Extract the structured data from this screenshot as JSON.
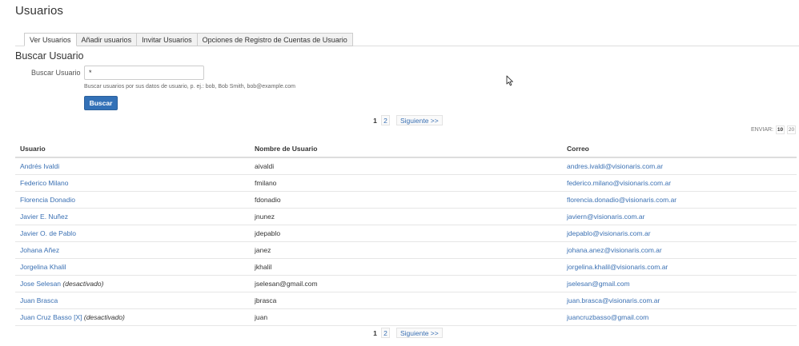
{
  "page": {
    "title": "Usuarios"
  },
  "tabs": [
    {
      "label": "Ver Usuarios",
      "active": true
    },
    {
      "label": "Añadir usuarios",
      "active": false
    },
    {
      "label": "Invitar Usuarios",
      "active": false
    },
    {
      "label": "Opciones de Registro de Cuentas de Usuario",
      "active": false
    }
  ],
  "search": {
    "section_title": "Buscar Usuario",
    "label": "Buscar Usuario",
    "value": "*",
    "help": "Buscar usuarios por sus datos de usuario, p. ej.: bob, Bob Smith, bob@example.com",
    "button_label": "Buscar"
  },
  "pagination": {
    "current": "1",
    "pages": [
      "2"
    ],
    "next_label": "Siguiente >>"
  },
  "per_page": {
    "label": "ENVIAR:",
    "options": [
      "10",
      "20"
    ],
    "selected": "10"
  },
  "table": {
    "columns": [
      "Usuario",
      "Nombre de Usuario",
      "Correo"
    ],
    "rows": [
      {
        "name": "Andrés Ivaldi",
        "status": "",
        "username": "aivaldi",
        "email": "andres.ivaldi@visionaris.com.ar"
      },
      {
        "name": "Federico Milano",
        "status": "",
        "username": "fmilano",
        "email": "federico.milano@visionaris.com.ar"
      },
      {
        "name": "Florencia Donadio",
        "status": "",
        "username": "fdonadio",
        "email": "florencia.donadio@visionaris.com.ar"
      },
      {
        "name": "Javier E. Nuñez",
        "status": "",
        "username": "jnunez",
        "email": "javiern@visionaris.com.ar"
      },
      {
        "name": "Javier O. de Pablo",
        "status": "",
        "username": "jdepablo",
        "email": "jdepablo@visionaris.com.ar"
      },
      {
        "name": "Johana Añez",
        "status": "",
        "username": "janez",
        "email": "johana.anez@visionaris.com.ar"
      },
      {
        "name": "Jorgelina Khalil",
        "status": "",
        "username": "jkhalil",
        "email": "jorgelina.khalil@visionaris.com.ar"
      },
      {
        "name": "Jose Selesan",
        "status": "(desactivado)",
        "username": "jselesan@gmail.com",
        "email": "jselesan@gmail.com"
      },
      {
        "name": "Juan Brasca",
        "status": "",
        "username": "jbrasca",
        "email": "juan.brasca@visionaris.com.ar"
      },
      {
        "name": "Juan Cruz Basso [X]",
        "status": "(desactivado)",
        "username": "juan",
        "email": "juancruzbasso@gmail.com"
      }
    ]
  },
  "colors": {
    "link": "#3a70b3",
    "primary_button": "#3371b7"
  },
  "icons": {
    "cursor": "mouse-pointer-icon"
  }
}
